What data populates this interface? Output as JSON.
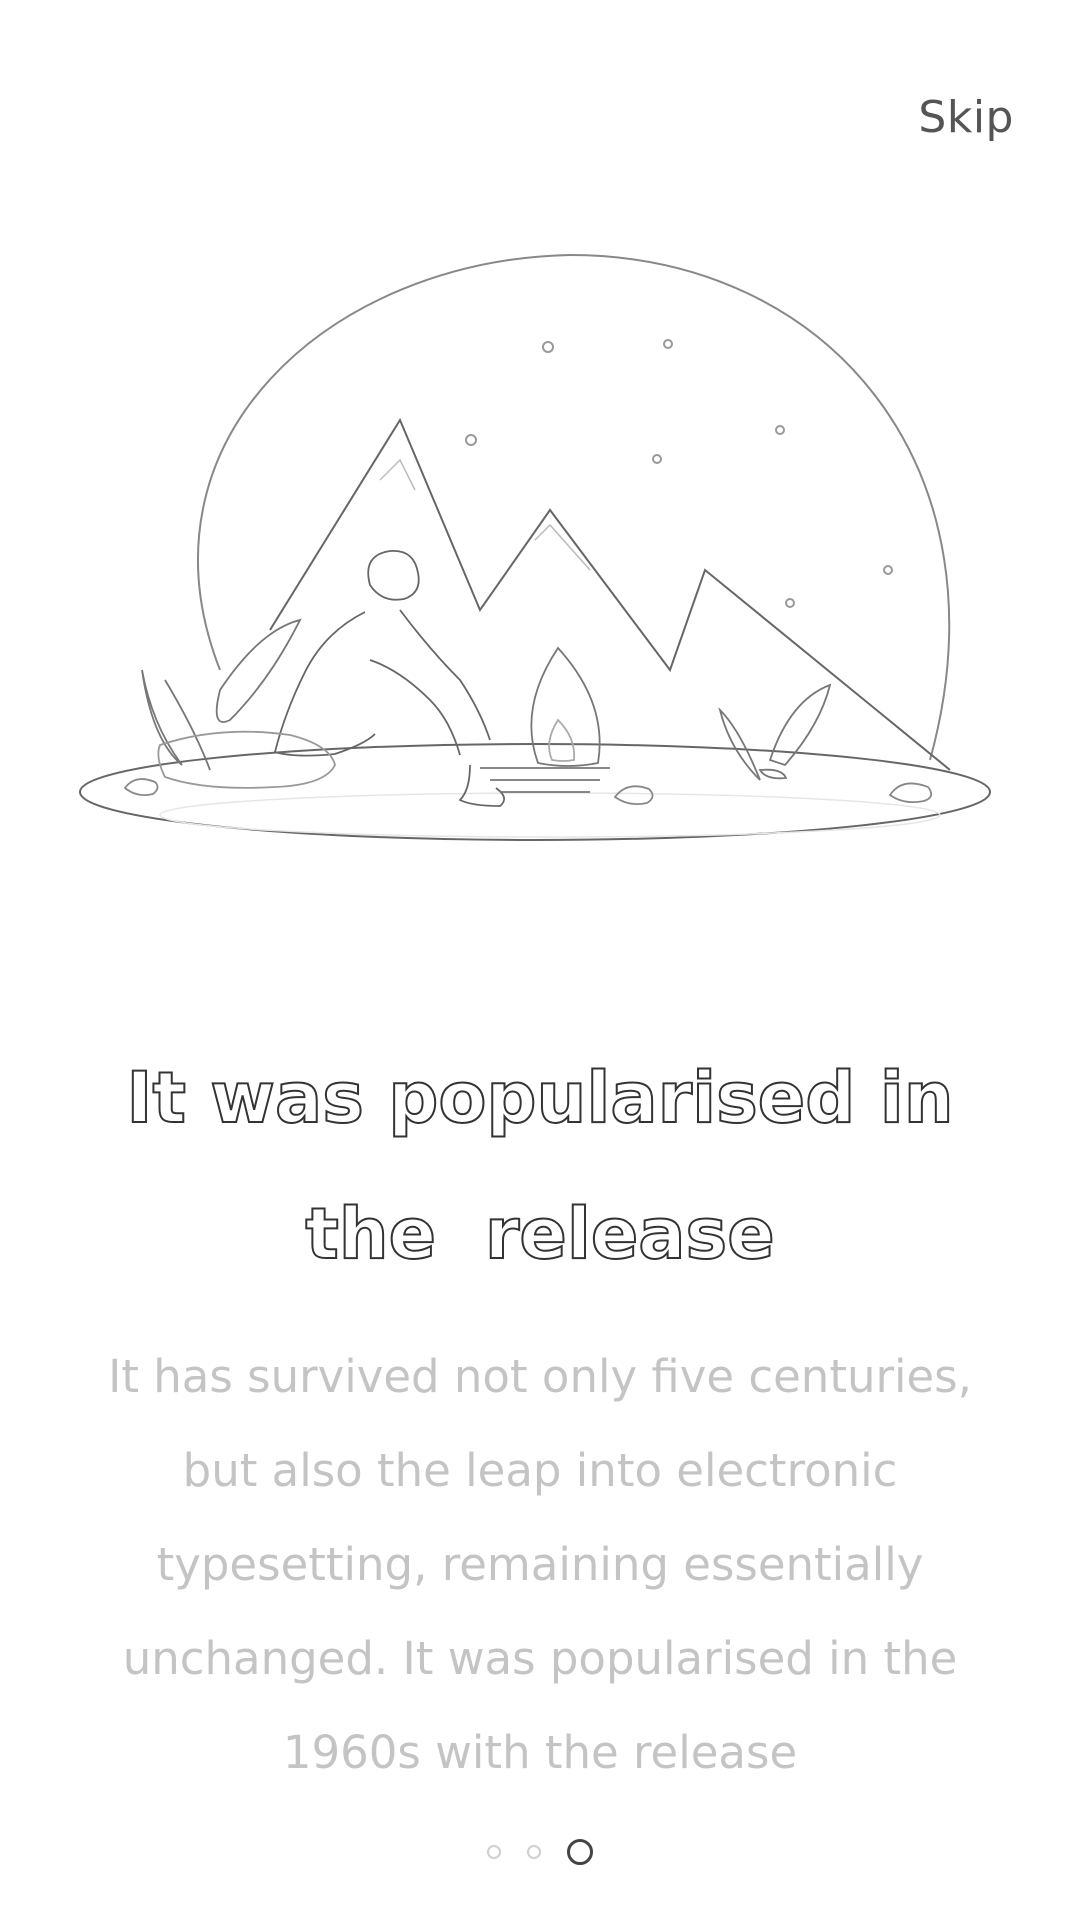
{
  "header": {
    "skip_label": "Skip"
  },
  "illustration": {
    "icon": "mountain-campfire-illustration"
  },
  "content": {
    "title_line1": "It was popularised in",
    "title_line2": "the  release",
    "description_lines": [
      "It has survived not only five centuries,",
      "but also the leap into electronic",
      "typesetting, remaining essentially",
      "unchanged. It was popularised in the",
      "1960s with the release"
    ]
  },
  "pager": {
    "total": 3,
    "active_index": 2
  },
  "colors": {
    "title_stroke": "#333333",
    "description": "#c4c4c4",
    "active_dot": "#444444",
    "inactive_dot": "#cfcfcf"
  }
}
